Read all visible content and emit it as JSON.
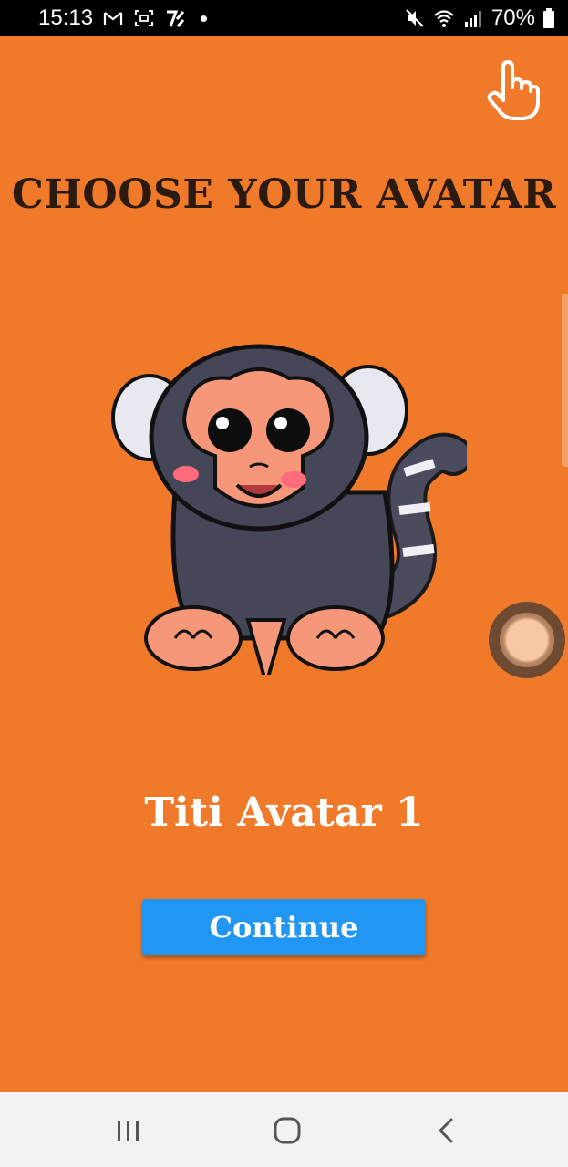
{
  "status_bar": {
    "time": "15:13",
    "battery_percent": "70%",
    "left_icons": [
      "gmail-icon",
      "screenshot-icon",
      "app-notification-icon",
      "dot-icon"
    ],
    "right_icons": [
      "mute-icon",
      "wifi-icon",
      "signal-icon",
      "battery-icon"
    ]
  },
  "screen": {
    "title": "CHOOSE YOUR AVATAR",
    "avatar_name": "Titi Avatar 1",
    "continue_label": "Continue",
    "top_right_icon": "hand-pointer-icon",
    "floating_icon": "assistive-touch-icon"
  },
  "nav_bar": {
    "buttons": [
      "recent-apps-icon",
      "home-icon",
      "back-icon"
    ]
  },
  "colors": {
    "background": "#f07a29",
    "title_text": "#2b1a10",
    "name_text": "#ffffff",
    "button": "#2196f3",
    "status_bar": "#000000",
    "nav_bar": "#f2f2f2"
  }
}
